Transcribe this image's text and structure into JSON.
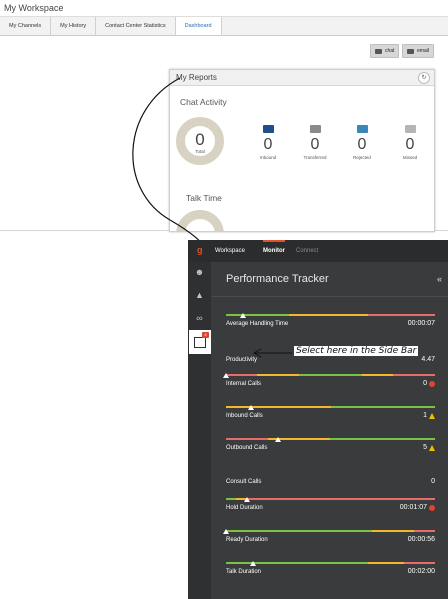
{
  "workspace": {
    "title": "My Workspace",
    "tabs": [
      "My Channels",
      "My History",
      "Contact Center Statistics",
      "Dashboard"
    ],
    "active_tab": 3,
    "buttons": {
      "chat": "chat",
      "email": "email"
    }
  },
  "reports": {
    "title": "My Reports",
    "chat_activity": {
      "title": "Chat Activity",
      "total_value": "0",
      "total_label": "Total",
      "stats": [
        {
          "value": "0",
          "label": "Inbound",
          "icon": "chat-inbound-icon",
          "color": "#1f4f8a"
        },
        {
          "value": "0",
          "label": "Transferred",
          "icon": "chat-transfer-icon",
          "color": "#8a8a8a"
        },
        {
          "value": "0",
          "label": "Rejected",
          "icon": "chat-rejected-icon",
          "color": "#3b87b8"
        },
        {
          "value": "0",
          "label": "Missed",
          "icon": "chat-missed-icon",
          "color": "#b5b5b5"
        }
      ]
    },
    "talk_time": {
      "title": "Talk Time"
    }
  },
  "tracker": {
    "nav": {
      "workspace": "Workspace",
      "monitor": "Monitor",
      "connect": "Connect"
    },
    "title": "Performance Tracker",
    "badge": "4",
    "callout": "Select here in the Side Bar",
    "rows": [
      {
        "label": "Average Handling Time",
        "value": "00:00:07",
        "status": "none",
        "marker": 0.08,
        "segments": [
          [
            "#7cc242",
            0.3
          ],
          [
            "#f3b72c",
            0.38
          ],
          [
            "#e86b6b",
            0.32
          ]
        ]
      },
      {
        "label": "Productivity",
        "value": "4.47",
        "status": "none",
        "marker": null,
        "segments": []
      },
      {
        "label": "Internal Calls",
        "value": "0",
        "status": "red",
        "marker": 0.0,
        "segments": [
          [
            "#e86b6b",
            0.15
          ],
          [
            "#f3b72c",
            0.2
          ],
          [
            "#7cc242",
            0.3
          ],
          [
            "#f3b72c",
            0.15
          ],
          [
            "#e86b6b",
            0.2
          ]
        ]
      },
      {
        "label": "Inbound Calls",
        "value": "1",
        "status": "warn",
        "marker": 0.12,
        "segments": [
          [
            "#f3b72c",
            0.5
          ],
          [
            "#7cc242",
            0.5
          ]
        ]
      },
      {
        "label": "Outbound Calls",
        "value": "5",
        "status": "warn",
        "marker": 0.25,
        "segments": [
          [
            "#e86b6b",
            0.2
          ],
          [
            "#f3b72c",
            0.3
          ],
          [
            "#7cc242",
            0.5
          ]
        ]
      },
      {
        "label": "Consult Calls",
        "value": "0",
        "status": "none",
        "marker": null,
        "segments": []
      },
      {
        "label": "Hold Duration",
        "value": "00:01:07",
        "status": "red",
        "marker": 0.1,
        "segments": [
          [
            "#7cc242",
            0.05
          ],
          [
            "#f3b72c",
            0.05
          ],
          [
            "#e86b6b",
            0.9
          ]
        ]
      },
      {
        "label": "Ready Duration",
        "value": "00:00:56",
        "status": "none",
        "marker": 0.0,
        "segments": [
          [
            "#7cc242",
            0.7
          ],
          [
            "#f3b72c",
            0.2
          ],
          [
            "#e86b6b",
            0.1
          ]
        ]
      },
      {
        "label": "Talk Duration",
        "value": "00:02:00",
        "status": "none",
        "marker": 0.13,
        "segments": [
          [
            "#7cc242",
            0.68
          ],
          [
            "#f3b72c",
            0.17
          ],
          [
            "#e86b6b",
            0.15
          ]
        ]
      }
    ]
  }
}
